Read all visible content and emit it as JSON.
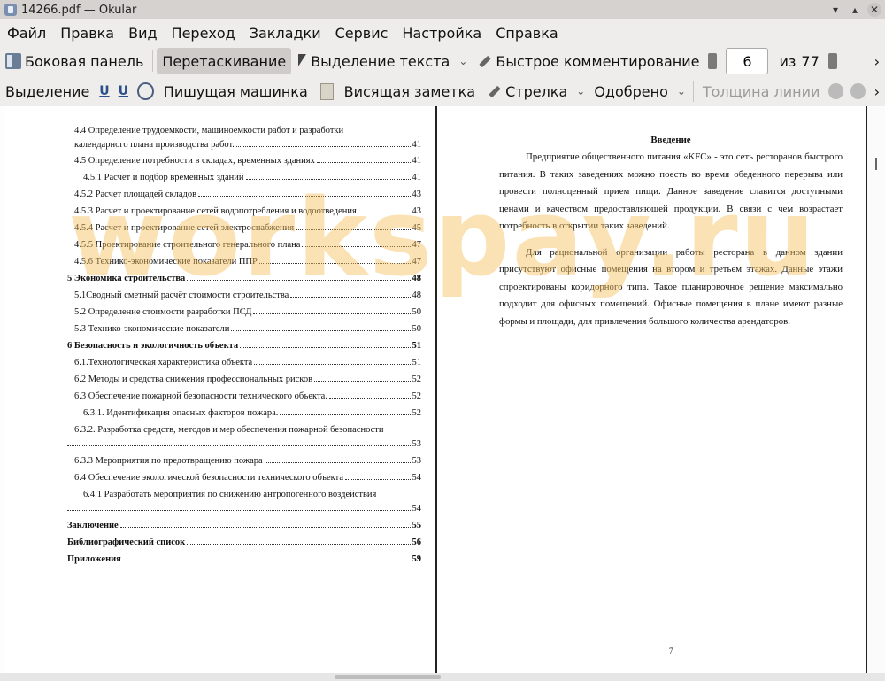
{
  "window": {
    "title": "14266.pdf — Okular",
    "accent": "#d6d2d0"
  },
  "menu": [
    "Файл",
    "Правка",
    "Вид",
    "Переход",
    "Закладки",
    "Сервис",
    "Настройка",
    "Справка"
  ],
  "toolbar1": {
    "sidebar_label": "Боковая панель",
    "browse_label": "Перетаскивание",
    "select_text_label": "Выделение текста",
    "quick_comment_label": "Быстрое комментирование",
    "page_current": "6",
    "page_of_label": "из",
    "page_total": "77",
    "more": "›"
  },
  "toolbar2": {
    "selection_label": "Выделение",
    "typewriter_label": "Пишущая машинка",
    "inline_note_label": "Висящая заметка",
    "arrow_label": "Стрелка",
    "approved_label": "Одобрено",
    "line_width_label": "Толщина линии",
    "more": "›"
  },
  "left_page": {
    "toc": [
      {
        "text": "4.4 Определение трудоемкости, машиноемкости работ и разработки",
        "text2": "календарного плана производства работ.",
        "page": "41",
        "indent": 1,
        "bold": false
      },
      {
        "text": "4.5 Определение потребности в складах, временных зданиях",
        "page": "41",
        "indent": 1,
        "bold": false
      },
      {
        "text": "4.5.1 Расчет и подбор временных зданий",
        "page": "41",
        "indent": 2,
        "bold": false
      },
      {
        "text": "4.5.2 Расчет площадей складов",
        "page": "43",
        "indent": 1,
        "bold": false
      },
      {
        "text": "4.5.3 Расчет и проектирование сетей водопотребления и водоотведения",
        "page": "43",
        "indent": 1,
        "bold": false
      },
      {
        "text": "4.5.4  Расчет и проектирование сетей электроснабжения",
        "page": "45",
        "indent": 1,
        "bold": false
      },
      {
        "text": "4.5.5 Проектирование строительного генерального плана",
        "page": "47",
        "indent": 1,
        "bold": false
      },
      {
        "text": "4.5.6 Технико-экономические показатели ППР",
        "page": "47",
        "indent": 1,
        "bold": false
      },
      {
        "text": "5 Экономика строительства",
        "page": "48",
        "indent": 0,
        "bold": true
      },
      {
        "text": "5.1Сводный сметный расчёт стоимости строительства",
        "page": "48",
        "indent": 1,
        "bold": false
      },
      {
        "text": "5.2 Определение стоимости разработки ПСД",
        "page": "50",
        "indent": 1,
        "bold": false
      },
      {
        "text": "5.3 Технико-экономические показатели",
        "page": "50",
        "indent": 1,
        "bold": false
      },
      {
        "text": "6 Безопасность и экологичность объекта",
        "page": "51",
        "indent": 0,
        "bold": true
      },
      {
        "text": "6.1.Технологическая характеристика объекта",
        "page": "51",
        "indent": 1,
        "bold": false
      },
      {
        "text": "6.2 Методы и средства снижения профессиональных рисков",
        "page": "52",
        "indent": 1,
        "bold": false
      },
      {
        "text": "6.3 Обеспечение пожарной безопасности технического объекта.",
        "page": "52",
        "indent": 1,
        "bold": false
      },
      {
        "text": "6.3.1. Идентификация опасных факторов пожара.",
        "page": "52",
        "indent": 2,
        "bold": false
      },
      {
        "text": "6.3.2. Разработка средств, методов и мер обеспечения пожарной безопасности",
        "text2": "",
        "page": "53",
        "indent": 1,
        "bold": false
      },
      {
        "text": "6.3.3 Мероприятия по предотвращению пожара",
        "page": "53",
        "indent": 1,
        "bold": false
      },
      {
        "text": "6.4 Обеспечение экологической безопасности технического объекта",
        "page": "54",
        "indent": 1,
        "bold": false
      },
      {
        "text": "6.4.1  Разработать мероприятия по снижению антропогенного воздействия",
        "text2": "",
        "page": "54",
        "indent": 2,
        "bold": false
      },
      {
        "text": "Заключение",
        "page": "55",
        "indent": 0,
        "bold": true
      },
      {
        "text": "Библиографический список",
        "page": "56",
        "indent": 0,
        "bold": true
      },
      {
        "text": "Приложения",
        "page": "59",
        "indent": 0,
        "bold": true
      }
    ]
  },
  "right_page": {
    "heading": "Введение",
    "paragraphs": [
      "Предприятие общественного питания «KFC» - это сеть ресторанов быстрого питания. В таких заведениях можно поесть во время обеденного перерыва или провести полноценный прием пищи. Данное заведение славится доступными ценами и качеством предоставляющей продукции. В связи с чем возрастает потребность в открытии таких заведений.",
      "Для рациональной организации работы ресторана в данном здании присутствуют офисные помещения на втором и третьем этажах. Данные этажи спроектированы коридорного типа. Такое планировочное решение максимально подходит для офисных помещений. Офисные помещения в плане имеют разные формы и площади, для привлечения большого количества арендаторов."
    ],
    "page_number": "7"
  },
  "watermark": "workspay.ru"
}
